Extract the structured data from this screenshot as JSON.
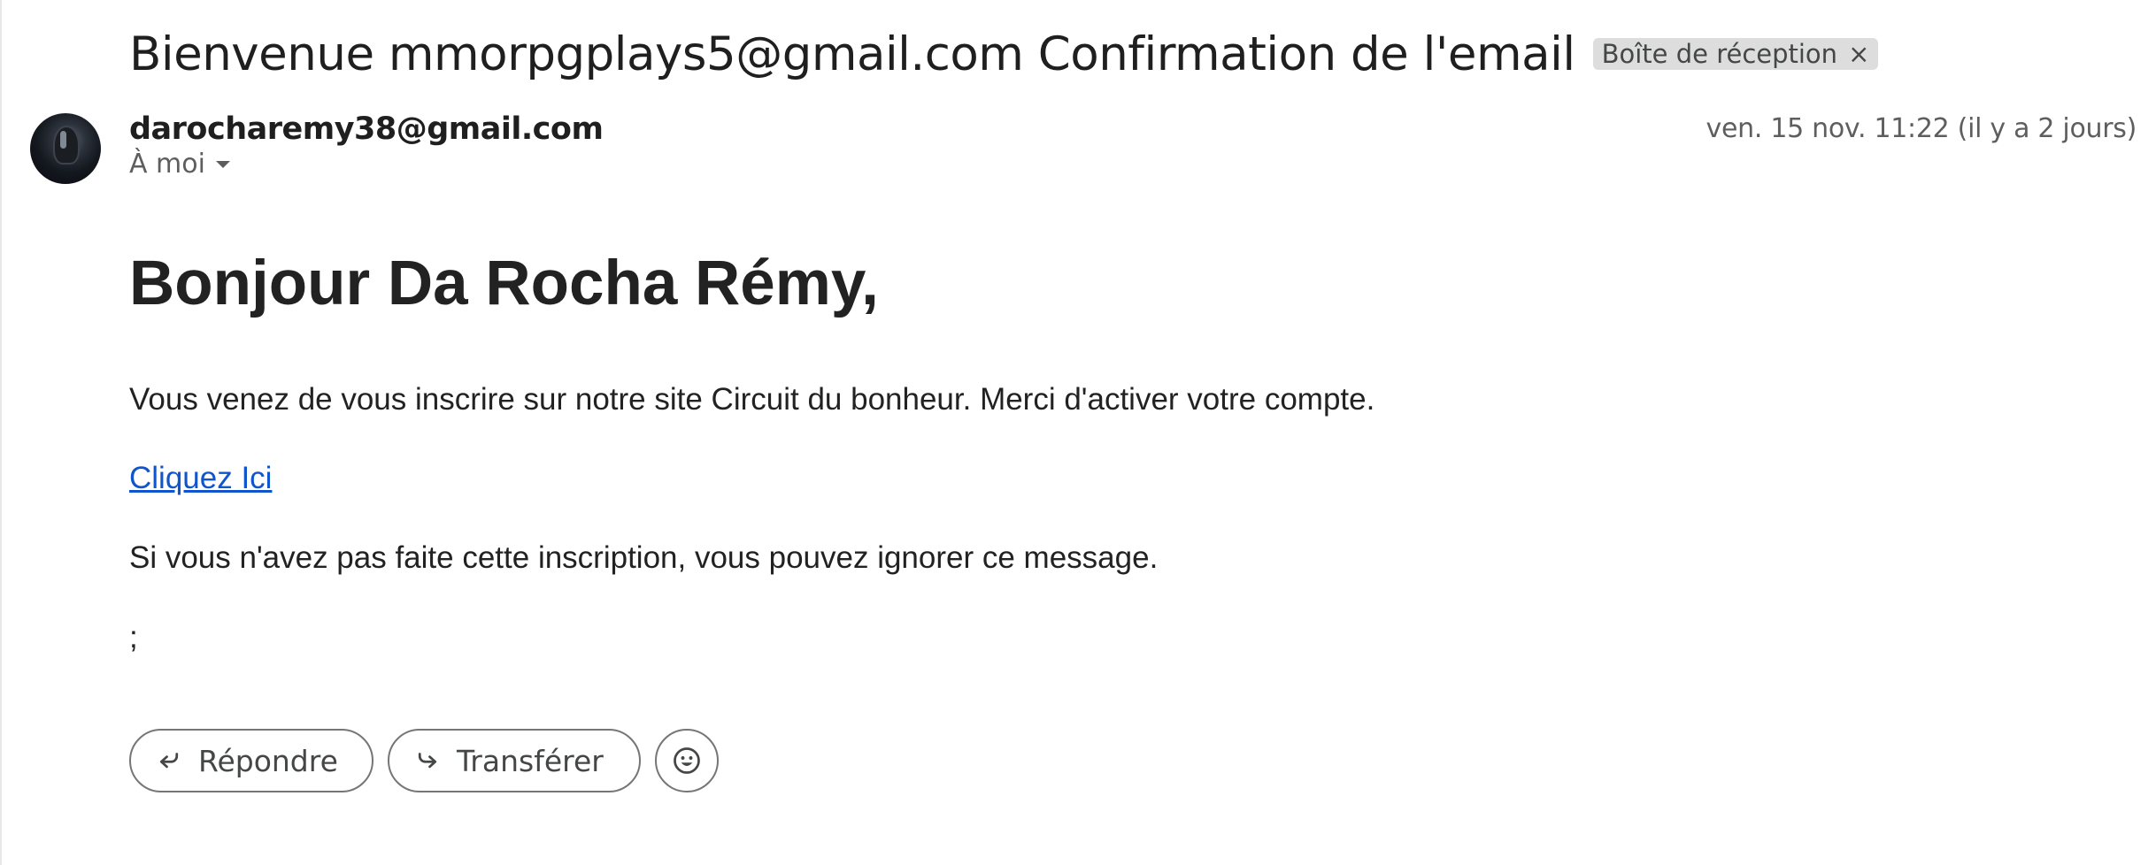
{
  "message": {
    "subject": "Bienvenue mmorpgplays5@gmail.com Confirmation de l'email",
    "label": "Boîte de réception",
    "label_remove": "×",
    "sender": "darocharemy38@gmail.com",
    "recipient": "À moi",
    "date": "ven. 15 nov. 11:22 (il y a 2 jours)"
  },
  "body": {
    "greeting": "Bonjour Da Rocha Rémy,",
    "paragraph1": "Vous venez de vous inscrire sur notre site Circuit du bonheur. Merci d'activer votre compte.",
    "link_text": "Cliquez Ici",
    "paragraph2": "Si vous n'avez pas faite cette inscription, vous pouvez ignorer ce message.",
    "paragraph3": ";"
  },
  "actions": {
    "reply_label": "Répondre",
    "forward_label": "Transférer"
  },
  "icons": {
    "reply": "reply-icon",
    "forward": "forward-icon",
    "emoji": "emoji-icon",
    "recipient_caret": "caret-down-icon"
  },
  "colors": {
    "link": "#1155cc",
    "label_chip": "#dddddd",
    "button_border": "#747775"
  }
}
